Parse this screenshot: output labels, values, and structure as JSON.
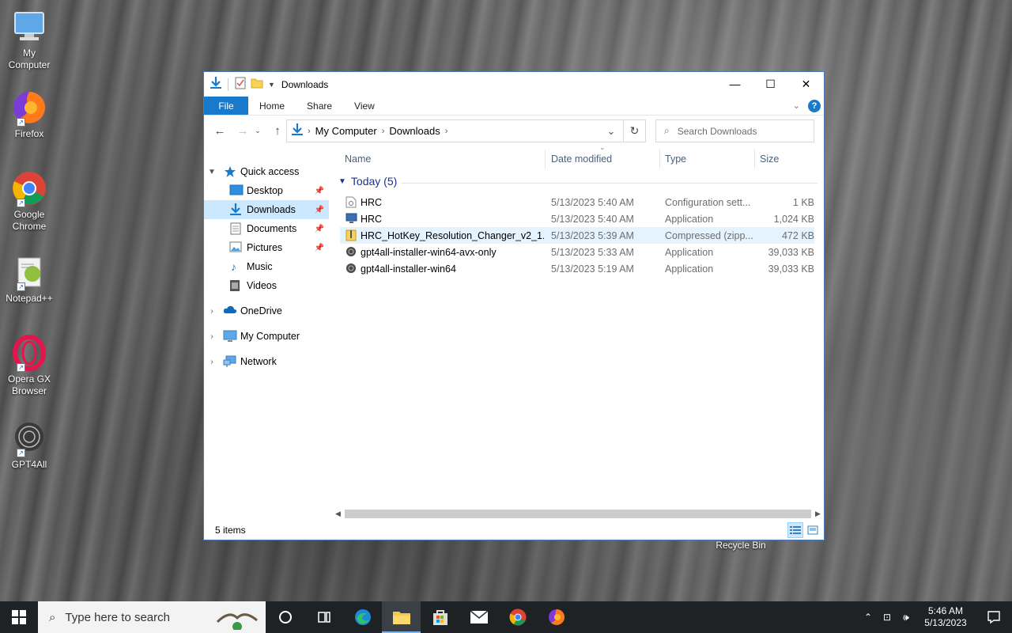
{
  "desktop": {
    "icons": [
      {
        "label": "My Computer",
        "icon": "computer-icon"
      },
      {
        "label": "Firefox",
        "icon": "firefox-icon"
      },
      {
        "label": "Google Chrome",
        "icon": "chrome-icon"
      },
      {
        "label": "Notepad++",
        "icon": "notepadpp-icon"
      },
      {
        "label": "Opera GX Browser",
        "icon": "opera-gx-icon"
      },
      {
        "label": "GPT4All",
        "icon": "gpt4all-icon"
      }
    ],
    "recycle_bin_label": "Recycle Bin"
  },
  "window": {
    "title": "Downloads",
    "ribbon_tabs": [
      "File",
      "Home",
      "Share",
      "View"
    ],
    "help": "?",
    "address": {
      "crumbs": [
        "My Computer",
        "Downloads"
      ]
    },
    "search_placeholder": "Search Downloads",
    "nav_pane": {
      "quick_access": "Quick access",
      "quick_items": [
        {
          "label": "Desktop",
          "pinned": true
        },
        {
          "label": "Downloads",
          "pinned": true,
          "selected": true
        },
        {
          "label": "Documents",
          "pinned": true
        },
        {
          "label": "Pictures",
          "pinned": true
        },
        {
          "label": "Music",
          "pinned": false
        },
        {
          "label": "Videos",
          "pinned": false
        }
      ],
      "roots": [
        "OneDrive",
        "My Computer",
        "Network"
      ]
    },
    "columns": [
      "Name",
      "Date modified",
      "Type",
      "Size"
    ],
    "group": {
      "label": "Today (5)"
    },
    "files": [
      {
        "name": "HRC",
        "date": "5/13/2023 5:40 AM",
        "type": "Configuration sett...",
        "size": "1 KB",
        "icon": "config-file-icon"
      },
      {
        "name": "HRC",
        "date": "5/13/2023 5:40 AM",
        "type": "Application",
        "size": "1,024 KB",
        "icon": "application-icon"
      },
      {
        "name": "HRC_HotKey_Resolution_Changer_v2_1...",
        "date": "5/13/2023 5:39 AM",
        "type": "Compressed (zipp...",
        "size": "472 KB",
        "icon": "zip-folder-icon"
      },
      {
        "name": "gpt4all-installer-win64-avx-only",
        "date": "5/13/2023 5:33 AM",
        "type": "Application",
        "size": "39,033 KB",
        "icon": "installer-icon"
      },
      {
        "name": "gpt4all-installer-win64",
        "date": "5/13/2023 5:19 AM",
        "type": "Application",
        "size": "39,033 KB",
        "icon": "installer-icon"
      }
    ],
    "status": "5 items"
  },
  "taskbar": {
    "search_placeholder": "Type here to search",
    "time": "5:46 AM",
    "date": "5/13/2023"
  },
  "colors": {
    "accent": "#1979ca",
    "selection": "#cce8ff",
    "hover": "#e5f3ff",
    "group_header": "#1e3287"
  }
}
